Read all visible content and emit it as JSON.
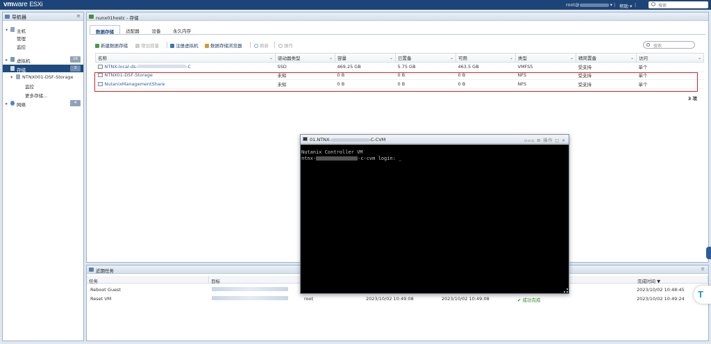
{
  "topbar": {
    "logo_vm": "vm",
    "logo_ware": "ware",
    "logo_esxi": "ESXi",
    "user": "root@",
    "help": "帮助",
    "search_placeholder": "搜索"
  },
  "navigator": {
    "title": "导航器",
    "items": [
      {
        "label": "主机"
      },
      {
        "label": "管理"
      },
      {
        "label": "监控"
      },
      {
        "label": "虚拟机",
        "badge": "16"
      },
      {
        "label": "存储",
        "badge": "3"
      },
      {
        "label": "NTNX001-DSF-Storage"
      },
      {
        "label": "监控"
      },
      {
        "label": "更多存储..."
      },
      {
        "label": "网络",
        "badge": "4"
      }
    ]
  },
  "main": {
    "title": "nunx01hostc - 存储",
    "tabs": [
      "数据存储",
      "适配器",
      "设备",
      "永久内存"
    ],
    "toolbar": {
      "new_datastore": "新建数据存储",
      "increase_capacity": "增加容量",
      "register_vm": "注册虚拟机",
      "datastore_browser": "数据存储浏览器",
      "refresh": "刷新",
      "actions": "操作"
    },
    "search_placeholder": "搜索",
    "columns": [
      "名称",
      "驱动器类型",
      "容量",
      "已置备",
      "可用",
      "类型",
      "精简置备",
      "访问"
    ],
    "rows": [
      [
        "NTNX-local-ds-",
        "SSD",
        "469.25 GB",
        "5.75 GB",
        "463.5 GB",
        "VMFS5",
        "受支持",
        "单个"
      ],
      [
        "NTNX01-DSF-Storage",
        "未知",
        "0 B",
        "0 B",
        "0 B",
        "NFS",
        "受支持",
        "单个"
      ],
      [
        "NutanixManagementShare",
        "未知",
        "0 B",
        "0 B",
        "0 B",
        "NFS",
        "受支持",
        "单个"
      ]
    ],
    "row0_suffix": "-C",
    "count": "3 项"
  },
  "tasks": {
    "title": "近期任务",
    "col_task": "任务",
    "col_target": "目标",
    "col_completed": "完成时间 ▼",
    "rows": [
      {
        "task": "Reboot Guest",
        "user": "",
        "queued": "",
        "started": "",
        "result": "",
        "completed": "2023/10/02 10:48:45"
      },
      {
        "task": "Reset VM",
        "user": "root",
        "queued": "2023/10/02 10:49:08",
        "started": "2023/10/02 10:49:08",
        "result": "成功完成",
        "completed": "2023/10/02 10:49:24"
      }
    ]
  },
  "console": {
    "title_prefix": "01.NTNX-",
    "title_suffix": "-C-CVM",
    "actions_label": "操作",
    "line1": "Nutanix Controller VM",
    "line2_prefix": "ntnx-",
    "line2_suffix": "-c-cvm login: _"
  }
}
